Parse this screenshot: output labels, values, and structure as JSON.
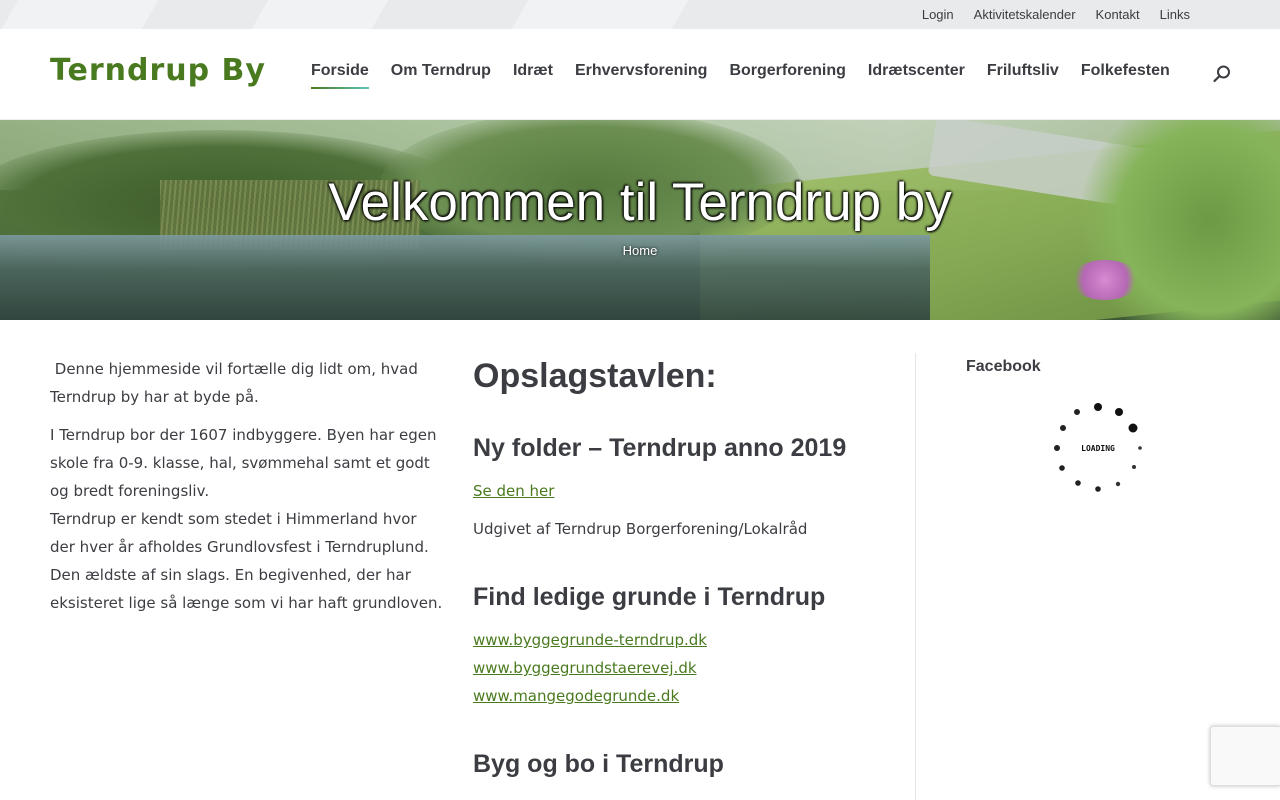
{
  "topbar": {
    "links": [
      "Login",
      "Aktivitetskalender",
      "Kontakt",
      "Links"
    ]
  },
  "header": {
    "logo": "Terndrup By",
    "nav": [
      "Forside",
      "Om Terndrup",
      "Idræt",
      "Erhvervsforening",
      "Borgerforening",
      "Idrætscenter",
      "Friluftsliv",
      "Folkefesten"
    ],
    "active_nav": "Forside"
  },
  "hero": {
    "title": "Velkommen til Terndrup by",
    "breadcrumb": "Home"
  },
  "left": {
    "p1": " Denne hjemmeside vil fortælle dig lidt om, hvad Terndrup by har at byde på.",
    "p2": "I Terndrup bor der 1607 indbyggere. Byen har egen skole fra 0-9. klasse, hal, svømmehal samt et godt og bredt foreningsliv.",
    "p3": "Terndrup er kendt som stedet i Himmerland hvor der hver år afholdes Grundlovsfest i Terndruplund. Den ældste af sin slags. En begivenhed, der har eksisteret lige så længe som vi har haft grundloven."
  },
  "middle": {
    "heading": "Opslagstavlen:",
    "section1": {
      "title": "Ny folder – Terndrup anno 2019",
      "link": "Se den her",
      "text": "Udgivet af Terndrup Borgerforening/Lokalråd"
    },
    "section2": {
      "title": "Find ledige grunde i Terndrup",
      "links": [
        "www.byggegrunde-terndrup.dk",
        "www.byggegrundstaerevej.dk",
        "www.mangegodegrunde.dk"
      ]
    },
    "section3": {
      "title": "Byg og bo i Terndrup"
    }
  },
  "right": {
    "heading": "Facebook",
    "loading": "LOADING"
  },
  "colors": {
    "brand_green": "#4a7a1f",
    "text_dark": "#3b3d42"
  }
}
